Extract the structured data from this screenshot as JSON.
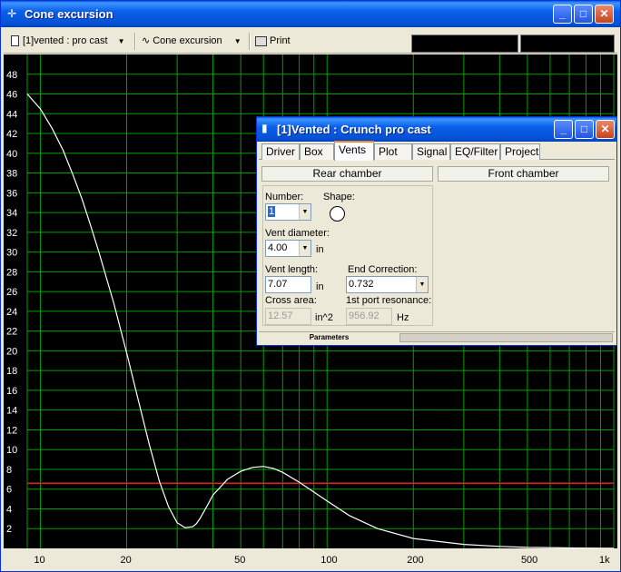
{
  "window": {
    "title": "Cone excursion",
    "minimize_label": "_",
    "maximize_label": "□",
    "close_label": "✕"
  },
  "toolbar": {
    "project_select": "[1]vented : pro cast",
    "graph_select": "Cone excursion",
    "print_label": "Print"
  },
  "chart_data": {
    "type": "line",
    "x_scale": "log",
    "x_ticks": [
      "10",
      "20",
      "50",
      "100",
      "200",
      "500",
      "1k"
    ],
    "y_ticks": [
      "2",
      "4",
      "6",
      "8",
      "10",
      "12",
      "14",
      "16",
      "18",
      "20",
      "22",
      "24",
      "26",
      "28",
      "30",
      "32",
      "34",
      "36",
      "38",
      "40",
      "42",
      "44",
      "46",
      "48"
    ],
    "xlim": [
      9,
      1000
    ],
    "ylim": [
      0,
      50
    ],
    "grid": true,
    "colors": {
      "background": "#000000",
      "grid": "#00a000",
      "curve": "#ffffff",
      "reference": "#e0202a"
    },
    "series": [
      {
        "x": [
          9,
          10,
          11,
          12,
          13,
          14,
          15,
          16,
          18,
          20,
          22,
          24,
          26,
          28,
          30,
          32,
          34,
          35,
          36,
          38,
          40,
          45,
          50,
          55,
          60,
          65,
          70,
          80,
          90,
          100,
          120,
          150,
          200,
          300,
          400,
          500,
          700,
          1000
        ],
        "y": [
          46,
          44.5,
          42.5,
          40.3,
          37.8,
          35.3,
          32.6,
          30,
          24.9,
          19.8,
          14.9,
          10.5,
          6.8,
          4.2,
          2.6,
          2.1,
          2.2,
          2.5,
          3,
          4.2,
          5.4,
          7,
          7.8,
          8.2,
          8.3,
          8.1,
          7.7,
          6.7,
          5.7,
          4.8,
          3.3,
          2,
          1,
          0.4,
          0.2,
          0.1,
          0.05,
          0.02
        ]
      }
    ],
    "reference_line_y": 6.6
  },
  "dialog": {
    "title": "[1]Vented : Crunch pro cast",
    "tabs": [
      {
        "label": "Driver"
      },
      {
        "label": "Box"
      },
      {
        "label": "Vents"
      },
      {
        "label": "Plot"
      },
      {
        "label": "Signal"
      },
      {
        "label": "EQ/Filter"
      },
      {
        "label": "Project"
      }
    ],
    "active_tab": "Vents",
    "rear_chamber": "Rear chamber",
    "front_chamber": "Front chamber",
    "number_label": "Number:",
    "number_value": "1",
    "shape_label": "Shape:",
    "vent_diameter_label": "Vent diameter:",
    "vent_diameter_value": "4.00",
    "vent_diameter_unit": "in",
    "vent_length_label": "Vent length:",
    "vent_length_value": "7.07",
    "vent_length_unit": "in",
    "end_correction_label": "End Correction:",
    "end_correction_value": "0.732",
    "cross_area_label": "Cross area:",
    "cross_area_value": "12.57",
    "cross_area_unit": "in^2",
    "port_resonance_label": "1st port resonance:",
    "port_resonance_value": "956.92",
    "port_resonance_unit": "Hz",
    "status_label": "Parameters"
  }
}
